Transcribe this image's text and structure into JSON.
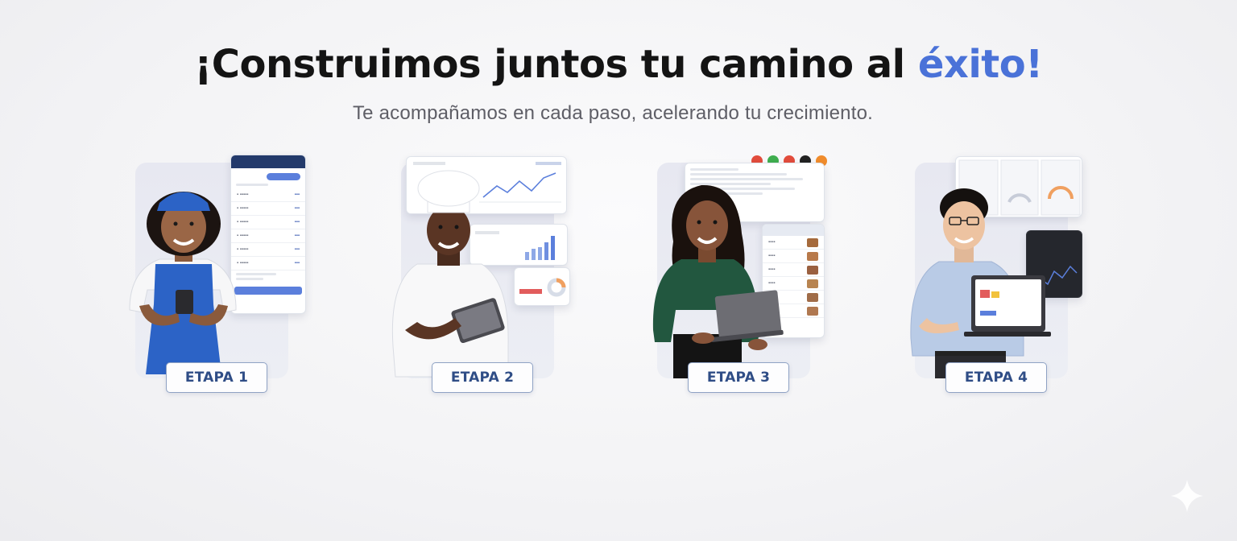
{
  "header": {
    "title_main": "¡Construimos juntos tu camino al ",
    "title_accent": "éxito!",
    "subtitle": "Te acompañamos en cada paso, acelerando tu crecimiento."
  },
  "stages": [
    {
      "label": "ETAPA 1"
    },
    {
      "label": "ETAPA 2"
    },
    {
      "label": "ETAPA 3"
    },
    {
      "label": "ETAPA 4"
    }
  ],
  "colors": {
    "accent": "#4a72d8",
    "badge_text": "#2f4d86",
    "badge_border": "#8fa2c4"
  }
}
